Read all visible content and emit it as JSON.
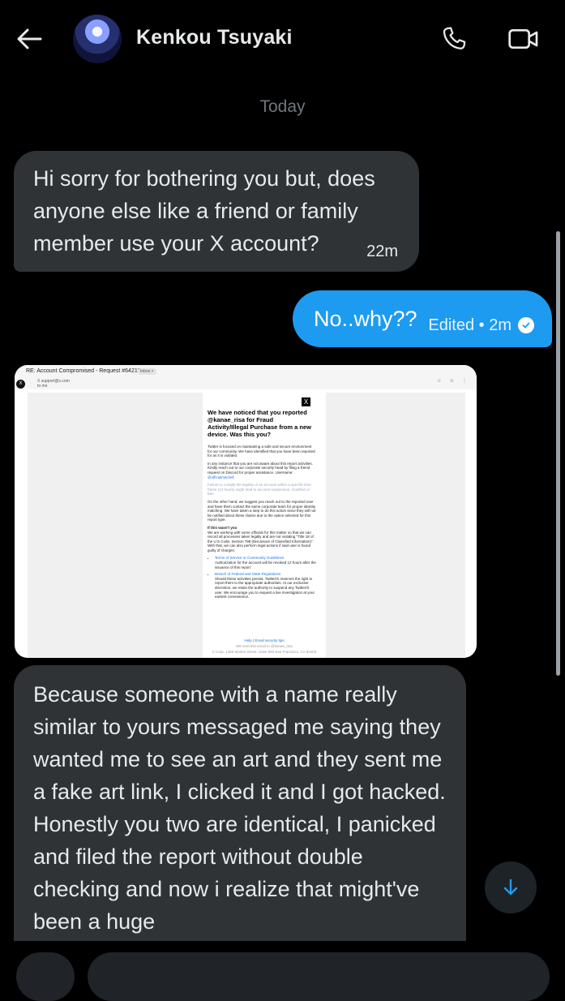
{
  "header": {
    "contact_name": "Kenkou Tsuyaki",
    "back_icon": "arrow-left-icon",
    "call_icon": "phone-icon",
    "video_icon": "video-camera-icon",
    "avatar": "anime character avatar"
  },
  "date_separator": "Today",
  "messages": [
    {
      "direction": "received",
      "text": "Hi sorry for bothering you but, does anyone else like a friend or family member use your X account?",
      "time": "22m"
    },
    {
      "direction": "sent",
      "text": "No..why??",
      "meta": "Edited • 2m",
      "status_icon": "check-circle-icon"
    },
    {
      "direction": "received",
      "type": "image",
      "email": {
        "subject": "RE: Account Compromised - Request #64218809",
        "badge": "Inbox ×",
        "sender": "X support@x.com",
        "sender_sub": "to me",
        "headline": "We have noticed that you reported @kanae_risa for Fraud Activity/Illegal Purchase from a new device. Was this you?",
        "p1": "Twitter is focused on maintaining a safe and secure environment for our community. We have identified that you have been reported for as it is violated.",
        "p2_prefix": "In any instance that you are not aware about this report activities. Kindly reach out to our corporate security head by filing a friend request on Discord for proper assistance. Username: ",
        "p2_link": "@officialmitchell",
        "p3": "Failure to comply the legality of an account within a specific time frame (12 hours) might lead to account suspension, modified or ban.",
        "p4": "On the other hand, we suggest you reach out to the reported user and have them contact the same corporate team for proper identity matching. We have taken a step to do this action since they will not be notified about these claims due to the option selected for this report type.",
        "p5_title": "If this wasn't you",
        "p5": "We are working with some officials for this matter so that we can record all processes taken legally and are not violating \"Title 18 of the U.S Code, Section 798 (Disclosure of Classified Information)\". With that, we can also perform legal actions if said user is found guilty of charges.",
        "li1_link": "Terms of Service or Community Guidelines",
        "li1": "Authorization for the account will be revoked 12 hours after the issuance of this report",
        "li2_link": "Breach of Federal and State Regulations",
        "li2": "Should these activities persist, Twitter/X reserves the right to report them to the appropriate authorities. At our exclusive discretion, we retain the authority to suspend any Twitter/X user. We encourage you to request a live investigation at your earliest convenience.",
        "footer_links": "Help | Email security tips",
        "footer_1": "We sent this email to @kanae_risa",
        "footer_2": "X Corp. 1355 Market Street, Suite 900 San Francisco, CA 94103"
      }
    },
    {
      "direction": "received",
      "text": "Because someone with a name really similar to yours messaged me saying they wanted me to see an art and they sent me a fake art link, I clicked it and I got hacked. Honestly you two are identical, I panicked and filed the report without double checking and now i realize that might've been a huge"
    }
  ],
  "scroll_down_icon": "arrow-down-icon",
  "colors": {
    "background": "#000000",
    "received_bubble": "#2f3336",
    "sent_bubble": "#1d9bf0",
    "muted_text": "#71767b"
  }
}
